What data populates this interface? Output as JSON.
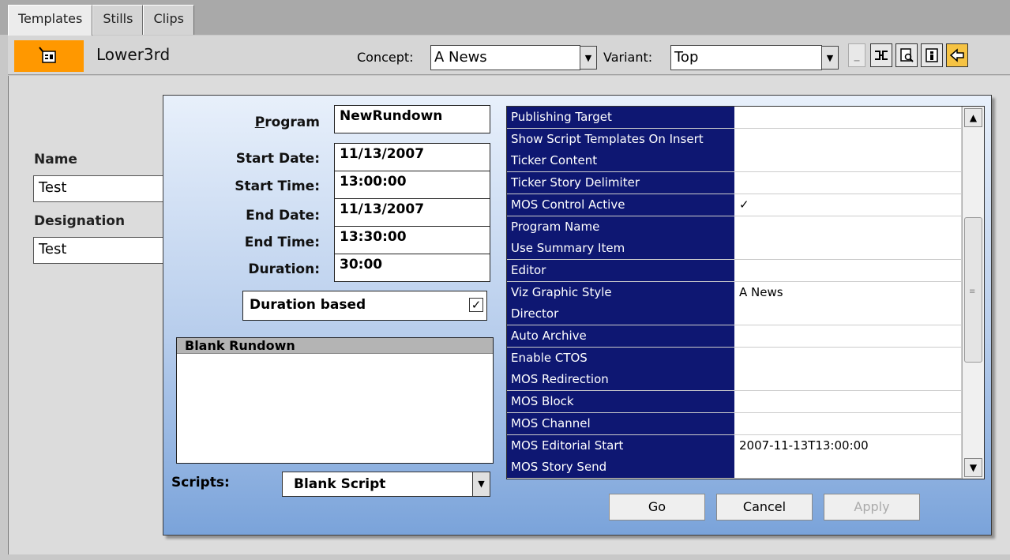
{
  "tabs": [
    "Templates",
    "Stills",
    "Clips"
  ],
  "toolbar": {
    "icon": "template-icon",
    "title": "Lower3rd",
    "concept_label": "Concept:",
    "concept_value": "A News",
    "variant_label": "Variant:",
    "variant_value": "Top",
    "small_button_label": "_"
  },
  "left_panel": {
    "name_label": "Name",
    "name_value": "Test",
    "designation_label": "Designation",
    "designation_value": "Test"
  },
  "dialog": {
    "program_label": "Program",
    "program_value": "NewRundown",
    "start_date_label": "Start Date:",
    "start_date_value": "11/13/2007",
    "start_time_label": "Start Time:",
    "start_time_value": "13:00:00",
    "end_date_label": "End Date:",
    "end_date_value": "11/13/2007",
    "end_time_label": "End Time:",
    "end_time_value": "13:30:00",
    "duration_label": "Duration:",
    "duration_value": "30:00",
    "duration_based_label": "Duration based",
    "duration_based_checked": "✓",
    "list_header": "Blank Rundown",
    "scripts_label": "Scripts:",
    "scripts_value": "Blank Script",
    "properties": [
      {
        "key": "Publishing Target",
        "value": ""
      },
      {
        "key": "Show Script Templates On Insert",
        "value": ""
      },
      {
        "key": "Ticker Content",
        "value": ""
      },
      {
        "key": "Ticker Story Delimiter",
        "value": ""
      },
      {
        "key": "MOS Control Active",
        "value": "✓"
      },
      {
        "key": "Program Name",
        "value": ""
      },
      {
        "key": "Use Summary Item",
        "value": ""
      },
      {
        "key": "Editor",
        "value": ""
      },
      {
        "key": "Viz Graphic Style",
        "value": "A News"
      },
      {
        "key": "Director",
        "value": ""
      },
      {
        "key": "Auto Archive",
        "value": ""
      },
      {
        "key": "Enable CTOS",
        "value": ""
      },
      {
        "key": "MOS Redirection",
        "value": ""
      },
      {
        "key": "MOS Block",
        "value": ""
      },
      {
        "key": "MOS Channel",
        "value": ""
      },
      {
        "key": "MOS Editorial Start",
        "value": "2007-11-13T13:00:00"
      },
      {
        "key": "MOS Story Send",
        "value": ""
      }
    ],
    "buttons": {
      "go": "Go",
      "cancel": "Cancel",
      "apply": "Apply"
    }
  },
  "colors": {
    "accent": "#ff9800",
    "grid_key_bg": "#0e1772"
  }
}
